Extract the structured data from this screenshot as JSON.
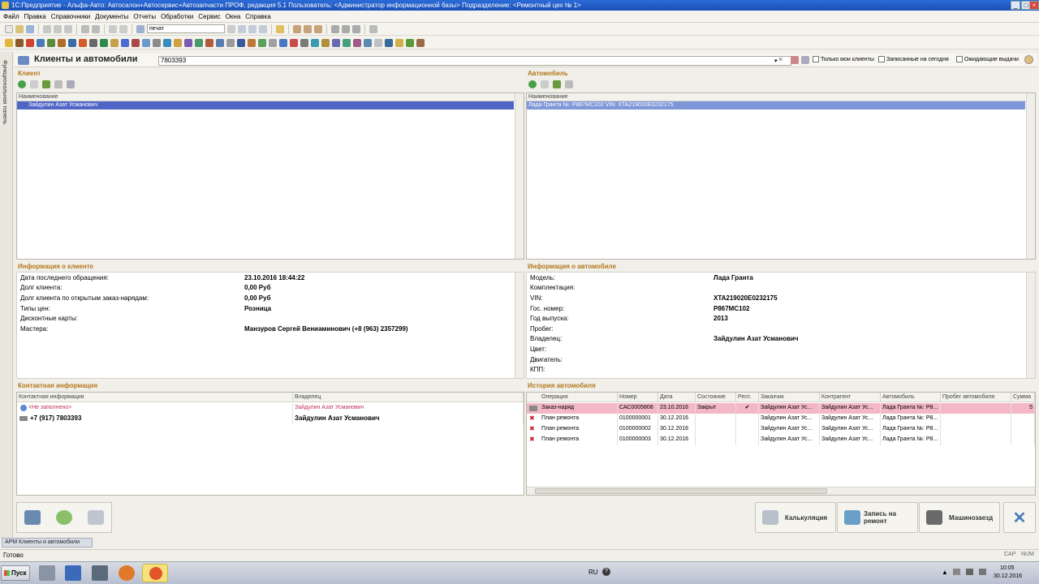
{
  "window": {
    "title": "1С:Предприятие - Альфа-Авто: Автосалон+Автосервис+Автозапчасти ПРОФ, редакция 5.1   Пользователь: <Администратор информационной базы>   Подразделение: <Ремонтный цех № 1>"
  },
  "menu": [
    "Файл",
    "Правка",
    "Справочники",
    "Документы",
    "Отчеты",
    "Обработки",
    "Сервис",
    "Окна",
    "Справка"
  ],
  "toolbar": {
    "search_value": "печат"
  },
  "sidebar": {
    "label": "Функциональная панель"
  },
  "form": {
    "title": "Клиенты и автомобили",
    "search_value": "7803393",
    "filters": [
      "Только мои клиенты",
      "Записанные на сегодня",
      "Ожидающие выдачи"
    ]
  },
  "client_section": {
    "title": "Клиент",
    "col_header": "Наименование",
    "rows": [
      "Зайдулин Азат Усманович"
    ]
  },
  "car_section": {
    "title": "Автомобиль",
    "col_header": "Наименование",
    "rows": [
      "Лада Гранта №: Р867МС102 VIN: XTA219020E0232175"
    ]
  },
  "client_info": {
    "title": "Информация о клиенте",
    "rows": [
      {
        "label": "Дата последнего обращения:",
        "value": "23.10.2016 18:44:22"
      },
      {
        "label": "Долг клиента:",
        "value": "0,00 Руб"
      },
      {
        "label": "Долг клиента по открытым заказ-нарядам:",
        "value": "0,00 Руб"
      },
      {
        "label": "Типы цен:",
        "value": "Розница"
      },
      {
        "label": "Дисконтные карты:",
        "value": ""
      },
      {
        "label": "Мастера:",
        "value": "Манзуров Сергей Вениаминович (+8 (963) 2357299)"
      }
    ]
  },
  "car_info": {
    "title": "Информация о автомобиле",
    "rows": [
      {
        "label": "Модель:",
        "value": "Лада Гранта"
      },
      {
        "label": "Комплектация:",
        "value": ""
      },
      {
        "label": "VIN:",
        "value": "XTA219020E0232175"
      },
      {
        "label": "Гос. номер:",
        "value": "Р867МС102"
      },
      {
        "label": "Год выпуска:",
        "value": "2013"
      },
      {
        "label": "Пробег:",
        "value": ""
      },
      {
        "label": "Владелец:",
        "value": "Зайдулин Азат Усманович"
      },
      {
        "label": "Цвет:",
        "value": ""
      },
      {
        "label": "Двигатель:",
        "value": ""
      },
      {
        "label": "КПП:",
        "value": ""
      }
    ]
  },
  "contacts": {
    "title": "Контактная информация",
    "headers": [
      "Контактная информация",
      "Владелец"
    ],
    "rows": [
      {
        "info": "<Не заполнено>",
        "owner": "Зайдулин Азат Усманович"
      },
      {
        "info": "+7 (917) 7803393",
        "owner": "Зайдулин Азат Усманович"
      }
    ]
  },
  "history": {
    "title": "История автомобиля",
    "headers": [
      "Операция",
      "Номер",
      "Дата",
      "Состояние",
      "Регл.",
      "Заказчик",
      "Контрагент",
      "Автомобиль",
      "Пробег автомобиля",
      "Сумма"
    ],
    "rows": [
      [
        "Заказ-наряд",
        "САС0005808",
        "23.10.2016",
        "Закрыт",
        "✔",
        "Зайдулин Азат Ус...",
        "Зайдулин Азат Ус...",
        "Лада Гранта №: Р8...",
        "",
        "5"
      ],
      [
        "План ремонта",
        "0100000001",
        "30.12.2016",
        "",
        "",
        "Зайдулин Азат Ус...",
        "Зайдулин Азат Ус...",
        "Лада Гранта №: Р8...",
        "",
        ""
      ],
      [
        "План ремонта",
        "0100000002",
        "30.12.2016",
        "",
        "",
        "Зайдулин Азат Ус...",
        "Зайдулин Азат Ус...",
        "Лада Гранта №: Р8...",
        "",
        ""
      ],
      [
        "План ремонта",
        "0100000003",
        "30.12.2016",
        "",
        "",
        "Зайдулин Азат Ус...",
        "Зайдулин Азат Ус...",
        "Лада Гранта №: Р8...",
        "",
        ""
      ]
    ]
  },
  "actions": {
    "calc": "Калькуляция",
    "repair": "Запись на ремонт",
    "entry": "Машинозаезд"
  },
  "window_tab": "АРМ Клиенты и автомобили",
  "status": {
    "ready": "Готово",
    "cap": "CAP",
    "num": "NUM"
  },
  "taskbar": {
    "start": "Пуск",
    "lang": "RU",
    "time": "10:05",
    "date": "30.12.2016"
  }
}
